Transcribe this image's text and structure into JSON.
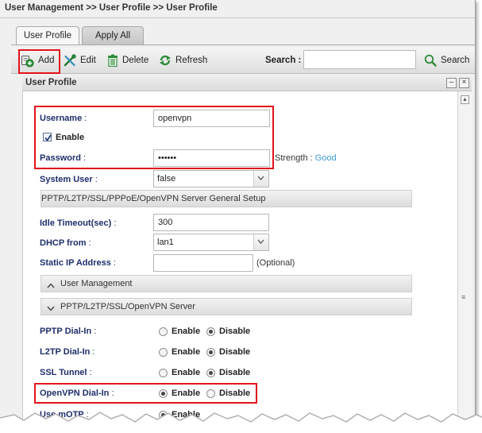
{
  "breadcrumb": "User Management >> User Profile >> User Profile",
  "tabs": [
    {
      "label": "User Profile",
      "active": true
    },
    {
      "label": "Apply All",
      "active": false
    }
  ],
  "toolbar": {
    "add_label": "Add",
    "edit_label": "Edit",
    "delete_label": "Delete",
    "refresh_label": "Refresh",
    "search_label": "Search :",
    "search_value": "",
    "search_button_label": "Search"
  },
  "panel": {
    "title": "User Profile",
    "minimize_glyph": "–",
    "close_glyph": "×"
  },
  "form": {
    "username_label": "Username",
    "username_value": "openvpn",
    "enable_label": "Enable",
    "enable_checked": true,
    "password_label": "Password",
    "password_value": "••••••",
    "strength_label": "Strength :",
    "strength_value": "Good",
    "system_user_label": "System User",
    "system_user_value": "false",
    "server_setup_header": "PPTP/L2TP/SSL/PPPoE/OpenVPN Server General Setup",
    "idle_timeout_label": "Idle Timeout(sec)",
    "idle_timeout_value": "300",
    "dhcp_from_label": "DHCP from",
    "dhcp_from_value": "lan1",
    "static_ip_label": "Static IP Address",
    "static_ip_value": "",
    "static_ip_hint": "(Optional)",
    "user_mgmt_section": "User Management",
    "vpn_server_section": "PPTP/L2TP/SSL/OpenVPN Server",
    "enable_option": "Enable",
    "disable_option": "Disable",
    "dialins": [
      {
        "label": "PPTP Dial-In",
        "selected": "Disable"
      },
      {
        "label": "L2TP Dial-In",
        "selected": "Disable"
      },
      {
        "label": "SSL Tunnel",
        "selected": "Disable"
      },
      {
        "label": "OpenVPN Dial-In",
        "selected": "Enable"
      },
      {
        "label": "Use mOTP",
        "selected": "Enable"
      }
    ]
  },
  "colors": {
    "label_blue": "#1e2e6b",
    "highlight_red": "#e2131b",
    "strength_blue": "#3a9bd6",
    "icon_green": "#2e8b3a"
  },
  "icons": {
    "add": "add-user-icon",
    "edit": "tools-edit-icon",
    "delete": "trash-icon",
    "refresh": "refresh-icon",
    "search": "magnifier-icon"
  }
}
